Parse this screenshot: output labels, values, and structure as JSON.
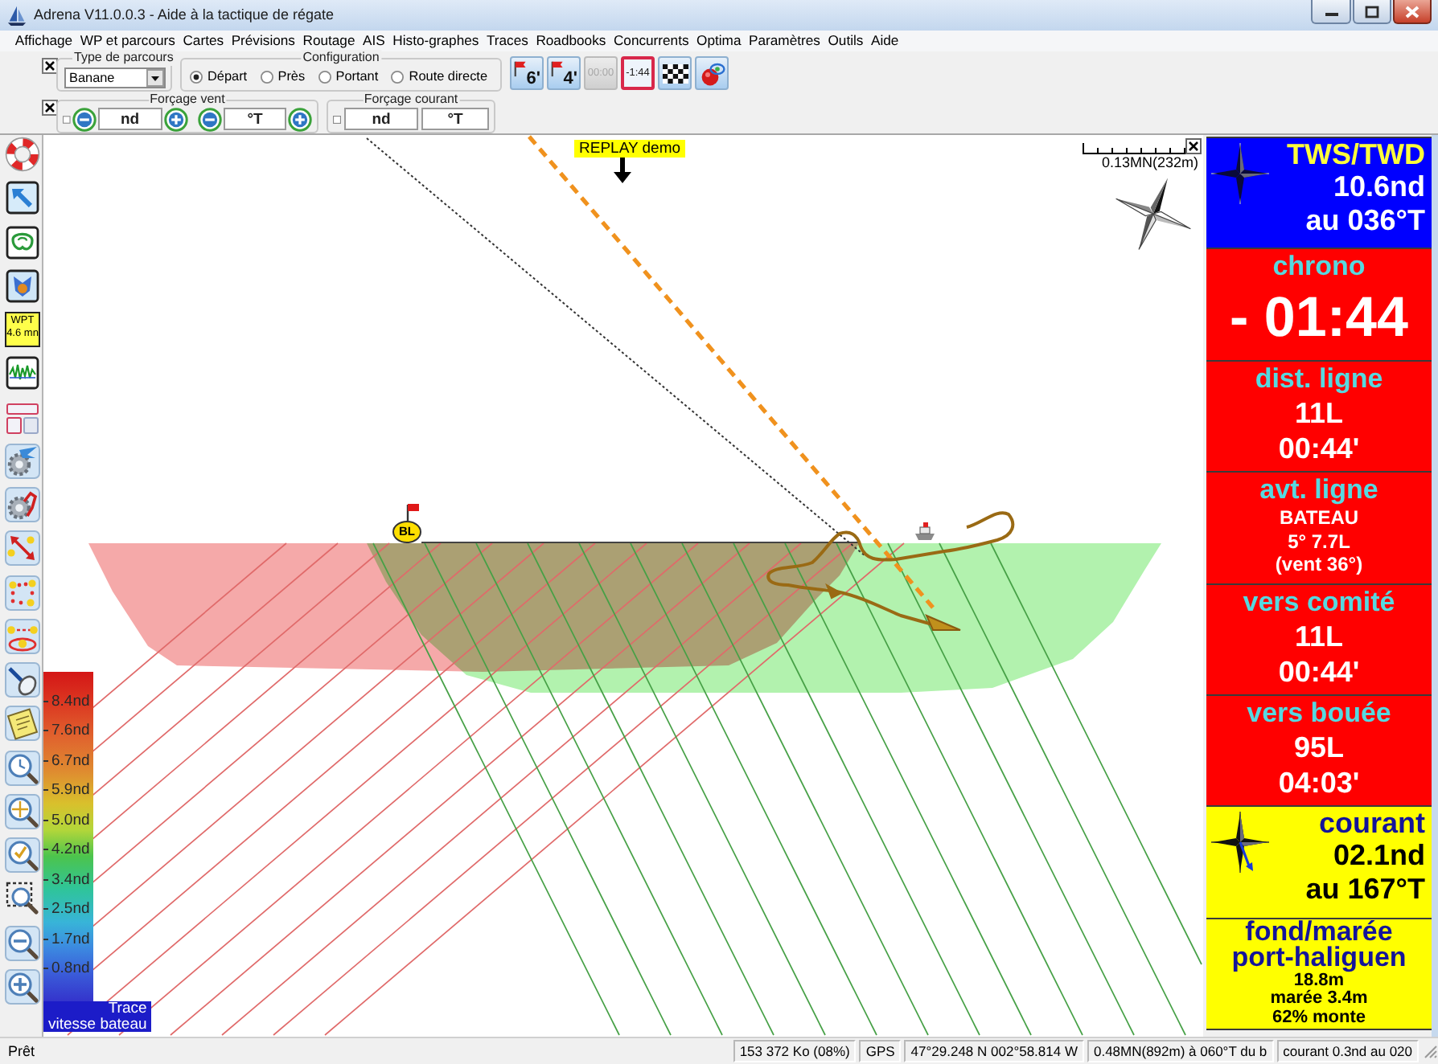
{
  "window": {
    "title": "Adrena V11.0.0.3 - Aide à la tactique de régate"
  },
  "menu": [
    "Affichage",
    "WP et parcours",
    "Cartes",
    "Prévisions",
    "Routage",
    "AIS",
    "Histo-graphes",
    "Traces",
    "Roadbooks",
    "Concurrents",
    "Optima",
    "Paramètres",
    "Outils",
    "Aide"
  ],
  "toolbar": {
    "course_type": {
      "legend": "Type de parcours",
      "value": "Banane"
    },
    "configuration": {
      "legend": "Configuration",
      "options": [
        {
          "label": "Départ",
          "selected": true
        },
        {
          "label": "Près",
          "selected": false
        },
        {
          "label": "Portant",
          "selected": false
        },
        {
          "label": "Route directe",
          "selected": false
        }
      ]
    },
    "buttons": [
      {
        "kind": "flag",
        "label": "6'"
      },
      {
        "kind": "flag",
        "label": "4'"
      },
      {
        "kind": "timer",
        "label": "00:00",
        "disabled": true
      },
      {
        "kind": "timer",
        "label": "-1:44",
        "disabled": false
      },
      {
        "kind": "checkered"
      },
      {
        "kind": "ball"
      }
    ],
    "wind_override": {
      "legend": "Forçage vent",
      "checked": false,
      "speed": "nd",
      "direction": "°T"
    },
    "current_override": {
      "legend": "Forçage courant",
      "checked": false,
      "speed": "nd",
      "direction": "°T"
    }
  },
  "left_tools": [
    {
      "kind": "lifebuoy"
    },
    {
      "kind": "arrow"
    },
    {
      "kind": "contour"
    },
    {
      "kind": "emblem"
    },
    {
      "kind": "waypoint",
      "lines": [
        "WPT",
        "4.6 mn"
      ]
    },
    {
      "kind": "waveform"
    },
    {
      "kind": "layout"
    },
    {
      "kind": "gear-plane"
    },
    {
      "kind": "gear-route"
    },
    {
      "kind": "double-arrow"
    },
    {
      "kind": "dots"
    },
    {
      "kind": "buoys"
    },
    {
      "kind": "lens"
    },
    {
      "kind": "note"
    },
    {
      "kind": "zoom-time"
    },
    {
      "kind": "zoom-center"
    },
    {
      "kind": "zoom-check"
    },
    {
      "kind": "zoom-area"
    },
    {
      "kind": "zoom-out"
    },
    {
      "kind": "zoom-in"
    }
  ],
  "map": {
    "replay": "REPLAY demo",
    "scale": "0.13MN(232m)",
    "start_mark": "BL",
    "legend": {
      "labels": [
        "8.4nd",
        "7.6nd",
        "6.7nd",
        "5.9nd",
        "5.0nd",
        "4.2nd",
        "3.4nd",
        "2.5nd",
        "1.7nd",
        "0.8nd"
      ],
      "caption": "Trace\nvitesse bateau"
    }
  },
  "panels": [
    {
      "kind": "compass",
      "color": "#0000ff",
      "title": "TWS/TWD",
      "lines": [
        "10.6nd",
        "au 036°T"
      ]
    },
    {
      "kind": "timer",
      "color": "#ff0000",
      "title": "chrono",
      "lines": [
        "- 01:44"
      ]
    },
    {
      "kind": "plain",
      "color": "#ff0000",
      "title": "dist. ligne",
      "lines": [
        "11L",
        "00:44'"
      ]
    },
    {
      "kind": "detail",
      "color": "#ff0000",
      "title": "avt. ligne",
      "lines": [
        "BATEAU",
        "5° 7.7L",
        "(vent 36°)"
      ]
    },
    {
      "kind": "plain",
      "color": "#ff0000",
      "title": "vers comité",
      "lines": [
        "11L",
        "00:44'"
      ]
    },
    {
      "kind": "plain",
      "color": "#ff0000",
      "title": "vers bouée",
      "lines": [
        "95L",
        "04:03'"
      ]
    },
    {
      "kind": "compass",
      "color": "#ffff00",
      "title": "courant",
      "lines": [
        "02.1nd",
        "au 167°T"
      ]
    },
    {
      "kind": "tide",
      "color": "#ffff00",
      "title": "fond/marée",
      "subtitle": "port-haliguen",
      "lines": [
        "18.8m",
        "marée 3.4m",
        "62% monte"
      ]
    }
  ],
  "status_bar": {
    "text": "Prêt",
    "cells": [
      "153 372 Ko (08%)",
      "GPS",
      "47°29.248 N 002°58.814 W",
      "0.48MN(892m) à 060°T du b",
      "courant 0.3nd au 020"
    ]
  }
}
